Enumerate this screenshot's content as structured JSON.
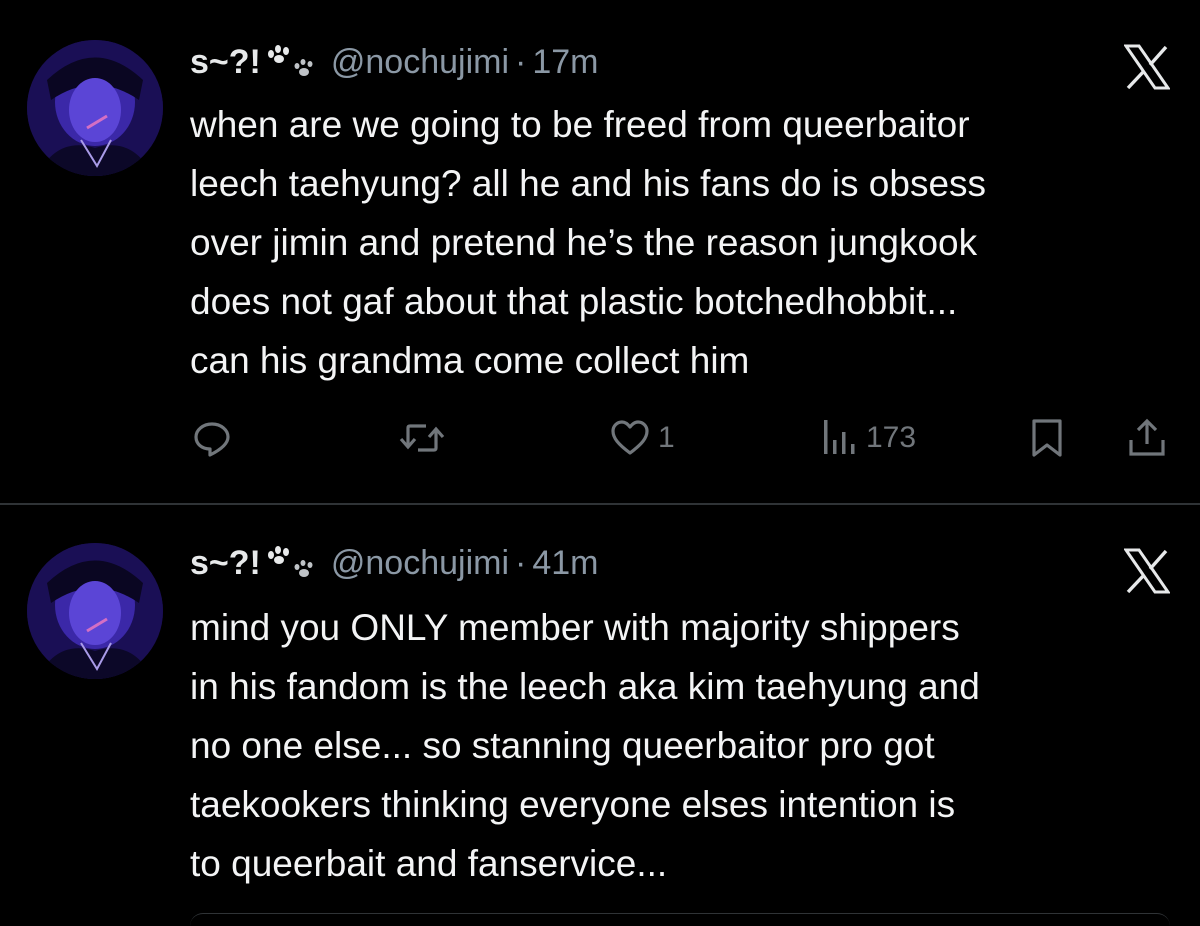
{
  "tweets": [
    {
      "display_name": "s~?!",
      "handle": "@nochujimi",
      "separator": "·",
      "time": "17m",
      "lines": [
        "when are we going to be freed from queerbaitor",
        "leech taehyung? all he and his fans do is obsess",
        "over jimin and pretend he’s the reason jungkook",
        "does not gaf about that plastic botchedhobbit...",
        "can his grandma come collect him"
      ],
      "likes": "1",
      "views": "173",
      "icons": {
        "brand": "x-logo-icon",
        "reply": "reply-bubble-icon",
        "repost": "repost-icon",
        "like": "heart-icon",
        "views": "bar-chart-icon",
        "bookmark": "bookmark-icon",
        "share": "share-upload-icon"
      }
    },
    {
      "display_name": "s~?!",
      "handle": "@nochujimi",
      "separator": "·",
      "time": "41m",
      "lines": [
        "mind you ONLY member with majority shippers",
        "in his fandom is the leech aka kim taehyung and",
        "no one else... so stanning queerbaitor pro got",
        "taekookers thinking everyone elses intention is",
        "to queerbait and fanservice..."
      ],
      "icons": {
        "brand": "x-logo-icon"
      }
    }
  ],
  "colors": {
    "background": "#000000",
    "text": "#e7e9ea",
    "secondary": "#71767b",
    "divider": "#2f3336"
  }
}
